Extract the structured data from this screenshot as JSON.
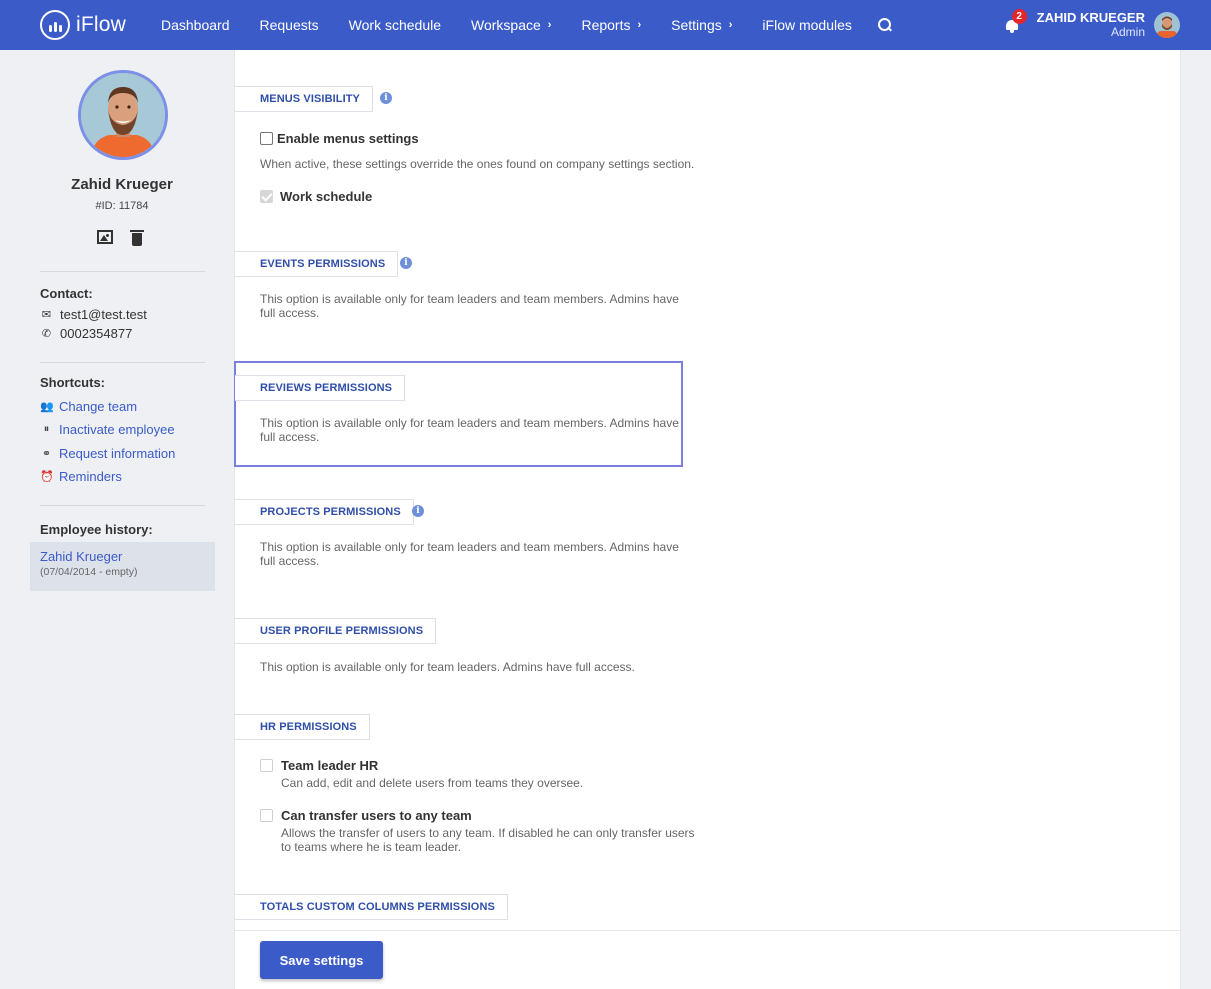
{
  "nav": {
    "brand": "iFlow",
    "items": [
      {
        "label": "Dashboard",
        "chevron": false
      },
      {
        "label": "Requests",
        "chevron": false
      },
      {
        "label": "Work schedule",
        "chevron": false
      },
      {
        "label": "Workspace",
        "chevron": true
      },
      {
        "label": "Reports",
        "chevron": true
      },
      {
        "label": "Settings",
        "chevron": true
      },
      {
        "label": "iFlow modules",
        "chevron": false
      }
    ],
    "notification_count": "2",
    "user_name": "ZAHID KRUEGER",
    "user_role": "Admin",
    "accent_color": "#3b5bc9",
    "badge_color": "#e3262c"
  },
  "profile": {
    "name": "Zahid Krueger",
    "id": "#ID: 11784",
    "contact_heading": "Contact:",
    "email": "test1@test.test",
    "phone": "0002354877",
    "shortcuts_heading": "Shortcuts:",
    "shortcuts": [
      {
        "label": "Change team",
        "icon": "users-icon"
      },
      {
        "label": "Inactivate employee",
        "icon": "pause-icon"
      },
      {
        "label": "Request information",
        "icon": "link-icon"
      },
      {
        "label": "Reminders",
        "icon": "alarm-clock-icon"
      }
    ],
    "history_heading": "Employee history:",
    "history": [
      {
        "name": "Zahid Krueger",
        "dates": "(07/04/2014 - empty)"
      }
    ]
  },
  "sections": {
    "menus": {
      "title": "MENUS VISIBILITY",
      "enable_label": "Enable menus settings",
      "enable_desc": "When active, these settings override the ones found on company settings section.",
      "work_schedule_label": "Work schedule"
    },
    "events": {
      "title": "EVENTS PERMISSIONS",
      "desc": "This option is available only for team leaders and team members. Admins have full access."
    },
    "reviews": {
      "title": "REVIEWS PERMISSIONS",
      "desc": "This option is available only for team leaders and team members. Admins have full access."
    },
    "projects": {
      "title": "PROJECTS PERMISSIONS",
      "desc": "This option is available only for team leaders and team members. Admins have full access."
    },
    "user_profile": {
      "title": "USER PROFILE PERMISSIONS",
      "desc": "This option is available only for team leaders. Admins have full access."
    },
    "hr": {
      "title": "HR PERMISSIONS",
      "team_leader_label": "Team leader HR",
      "team_leader_desc": "Can add, edit and delete users from teams they oversee.",
      "transfer_label": "Can transfer users to any team",
      "transfer_desc": "Allows the transfer of users to any team. If disabled he can only transfer users to teams where he is team leader."
    },
    "totals": {
      "title": "TOTALS CUSTOM COLUMNS PERMISSIONS"
    }
  },
  "save_label": "Save settings"
}
